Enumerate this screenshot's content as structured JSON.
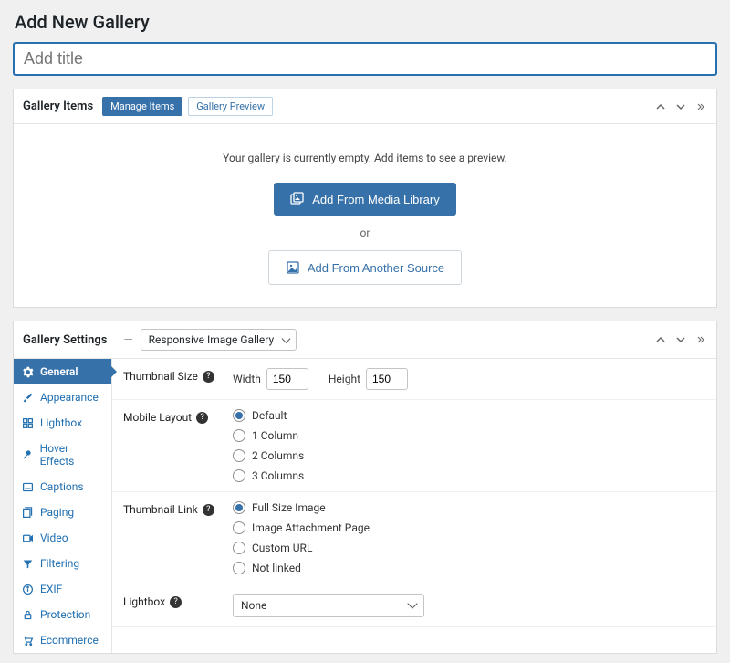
{
  "page": {
    "title": "Add New Gallery",
    "title_placeholder": "Add title"
  },
  "items_panel": {
    "label": "Gallery Items",
    "tabs": {
      "manage": "Manage Items",
      "preview": "Gallery Preview"
    },
    "empty_msg": "Your gallery is currently empty. Add items to see a preview.",
    "btn_media": "Add From Media Library",
    "or": "or",
    "btn_other": "Add From Another Source"
  },
  "settings_panel": {
    "label": "Gallery Settings",
    "template_select": "Responsive Image Gallery",
    "tabs": [
      "General",
      "Appearance",
      "Lightbox",
      "Hover Effects",
      "Captions",
      "Paging",
      "Video",
      "Filtering",
      "EXIF",
      "Protection",
      "Ecommerce"
    ],
    "fields": {
      "thumb_size": {
        "label": "Thumbnail Size",
        "width_label": "Width",
        "width": "150",
        "height_label": "Height",
        "height": "150"
      },
      "mobile_layout": {
        "label": "Mobile Layout",
        "options": [
          "Default",
          "1 Column",
          "2 Columns",
          "3 Columns"
        ],
        "selected": 0
      },
      "thumb_link": {
        "label": "Thumbnail Link",
        "options": [
          "Full Size Image",
          "Image Attachment Page",
          "Custom URL",
          "Not linked"
        ],
        "selected": 0
      },
      "lightbox": {
        "label": "Lightbox",
        "value": "None"
      }
    }
  }
}
